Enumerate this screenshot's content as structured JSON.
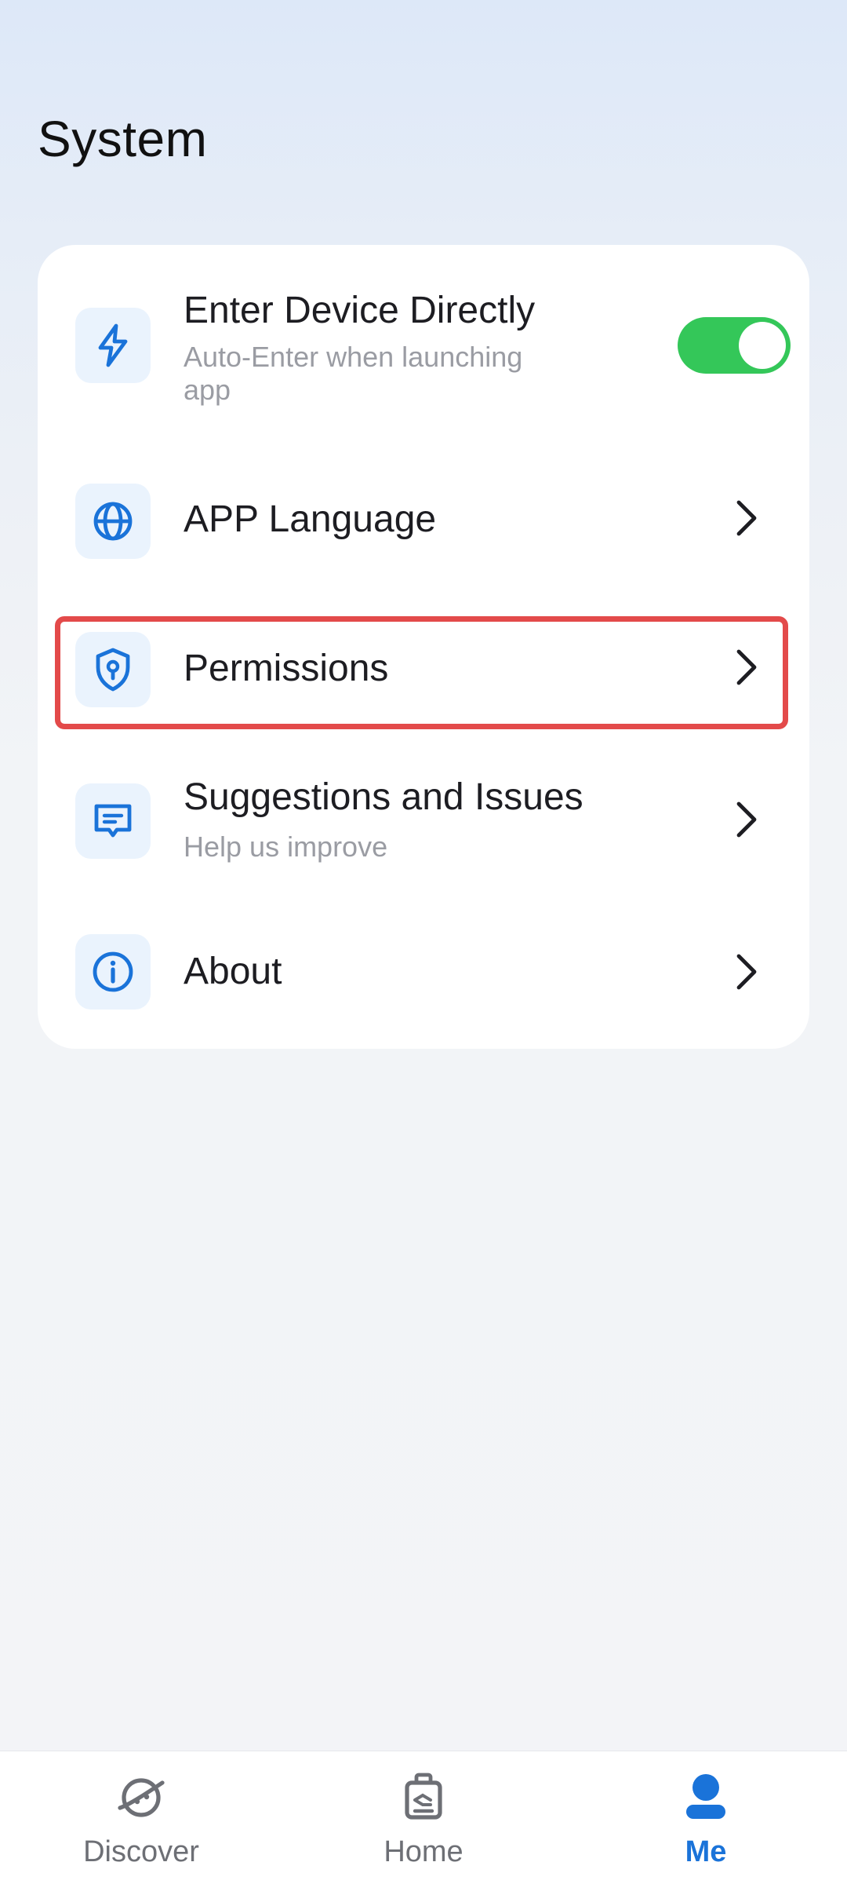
{
  "header": {
    "title": "System"
  },
  "settings": {
    "enter_device": {
      "title": "Enter Device Directly",
      "subtitle": "Auto-Enter when launching app",
      "toggle_on": true,
      "icon": "lightning-icon"
    },
    "language": {
      "title": "APP Language",
      "icon": "globe-icon"
    },
    "permissions": {
      "title": "Permissions",
      "icon": "shield-keyhole-icon"
    },
    "suggestions": {
      "title": "Suggestions and Issues",
      "subtitle": "Help us improve",
      "icon": "message-icon"
    },
    "about": {
      "title": "About",
      "icon": "info-icon"
    }
  },
  "tabbar": {
    "discover": {
      "label": "Discover",
      "icon": "planet-icon"
    },
    "home": {
      "label": "Home",
      "icon": "device-icon"
    },
    "me": {
      "label": "Me",
      "icon": "person-icon",
      "active": true
    }
  },
  "colors": {
    "accent": "#1a73d9",
    "toggle_on": "#34c759",
    "highlight": "#e34a4a",
    "icon_bg": "#eaf3fd"
  }
}
